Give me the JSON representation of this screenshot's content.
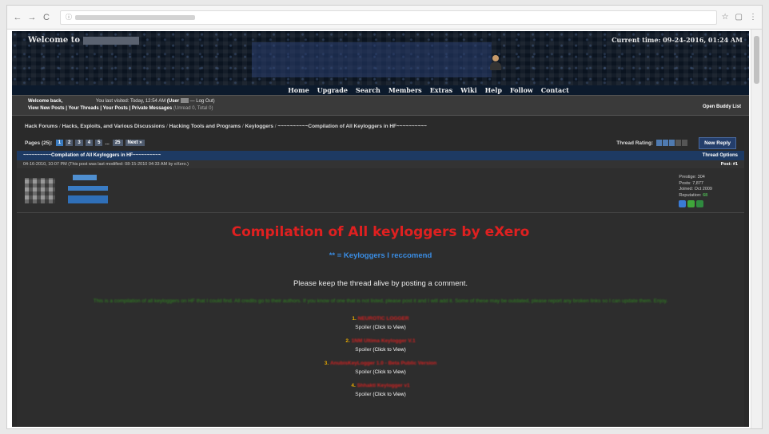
{
  "browser": {
    "nav_back": "←",
    "nav_forward": "→",
    "nav_reload": "C",
    "icons": [
      "☆",
      "▢",
      "⋮"
    ]
  },
  "header": {
    "welcome_prefix": "Welcome to",
    "current_time": "Current time: 09-24-2016, 01:24 AM"
  },
  "nav": {
    "items": [
      "Home",
      "Upgrade",
      "Search",
      "Members",
      "Extras",
      "Wiki",
      "Help",
      "Follow",
      "Contact"
    ]
  },
  "userbar": {
    "welcome_back": "Welcome back,",
    "last_visited": "You last visited: Today, 12:54 AM",
    "user_open": "(User",
    "logout": "— Log Out)",
    "links": "View New Posts | Your Threads | Your Posts | Private Messages",
    "pm_count": "(Unread 0, Total 0)",
    "buddy": "Open Buddy List"
  },
  "breadcrumb": {
    "parts": [
      "Hack Forums",
      "Hacks, Exploits, and Various Discussions",
      "Hacking Tools and Programs",
      "Keyloggers"
    ],
    "current": "~~~~~~~~~~Compilation of All Keyloggers in HF~~~~~~~~~~",
    "sep": "/"
  },
  "pager": {
    "label": "Pages (25):",
    "pages": [
      "1",
      "2",
      "3",
      "4",
      "5",
      "...",
      "25"
    ],
    "next": "Next »",
    "rating_label": "Thread Rating:",
    "new_reply": "New Reply"
  },
  "thread": {
    "title": "~~~~~~~~~~Compilation of All Keyloggers in HF~~~~~~~~~~",
    "options": "Thread Options",
    "post_date": "04-16-2010, 10:07 PM (This post was last modified: 08-15-2010 04:33 AM by eXero.)",
    "post_num": "Post: #1"
  },
  "author": {
    "prestige": "Prestige: 304",
    "posts": "Posts: 7,877",
    "joined": "Joined: Oct 2009",
    "reputation_label": "Reputation:",
    "reputation": "68",
    "badge_colors": [
      "#3a7bd5",
      "#3fa63a",
      "#2f8a3f"
    ]
  },
  "post": {
    "title": "Compilation of All keyloggers by eXero",
    "recommend": "** = Keyloggers I reccomend",
    "keep_alive": "Please keep the thread alive by posting a comment.",
    "green_text": "This is a compilation of all keyloggers on HF that I could find. All credits go to their authors. If you know of one that is not listed, please post it and I will add it. Some of these may be outdated, please report any broken links so I can update them. Enjoy.",
    "keyloggers": [
      {
        "num": "1.",
        "name": "NEUROTIC LOGGER"
      },
      {
        "num": "2.",
        "name": "1NM Ultima Keylogger V.1"
      },
      {
        "num": "3.",
        "name": "AnubisKeyLogger 1.0 - Beta Public Version"
      },
      {
        "num": "4.",
        "name": "Shhakti Keylogger v1"
      }
    ],
    "spoiler_label": "Spoiler",
    "spoiler_click": "(Click to View)"
  }
}
